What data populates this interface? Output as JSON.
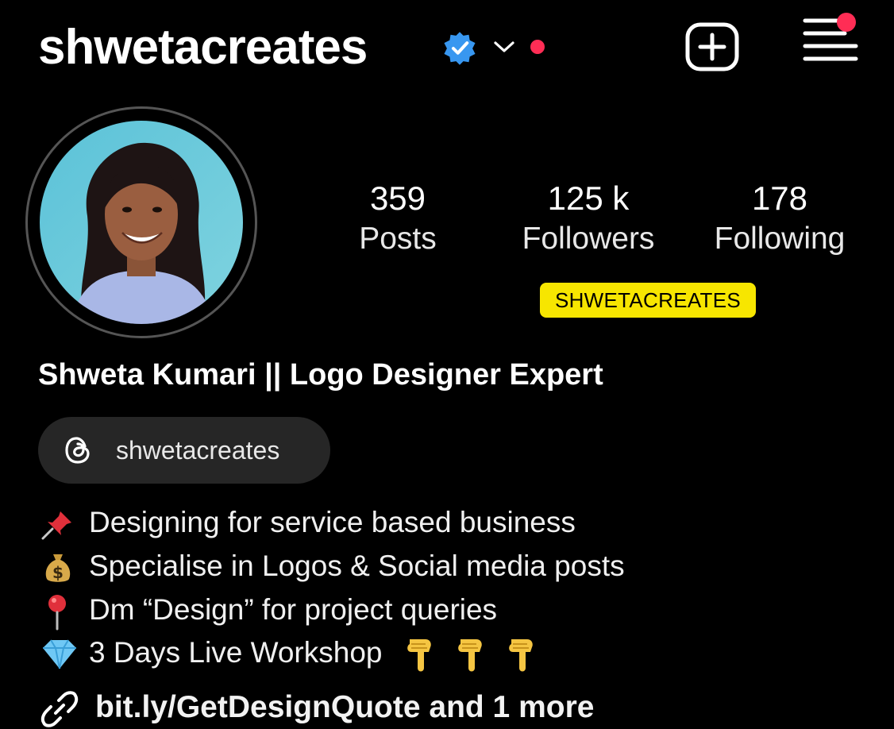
{
  "header": {
    "username": "shwetacreates",
    "icons": [
      "verified-badge-icon",
      "chevron-down-icon",
      "notification-dot",
      "create-post-icon",
      "menu-icon"
    ],
    "accent_verified": "#3897f0",
    "accent_badge": "#ff2d55"
  },
  "profile": {
    "avatar": "profile-photo",
    "stats": [
      {
        "value": "359",
        "label": "Posts"
      },
      {
        "value": "125 k",
        "label": "Followers"
      },
      {
        "value": "178",
        "label": "Following"
      }
    ],
    "overlay_tag": "SHWETACREATES",
    "overlay_tag_color": "#f7e600"
  },
  "bio": {
    "display_name": "Shweta Kumari || Logo Designer Expert",
    "threads_handle": "shwetacreates",
    "lines": [
      {
        "icon": "pushpin-icon",
        "text": "Designing for service based business"
      },
      {
        "icon": "money-bag-icon",
        "text": "Specialise in Logos & Social media posts"
      },
      {
        "icon": "round-pushpin-icon",
        "text": "Dm “Design” for project queries"
      },
      {
        "icon": "gem-icon",
        "text": "3 Days Live Workshop"
      }
    ],
    "pointing_icons": [
      "pointing-down-icon",
      "pointing-down-icon",
      "pointing-down-icon"
    ],
    "link": "bit.ly/GetDesignQuote and 1 more"
  }
}
